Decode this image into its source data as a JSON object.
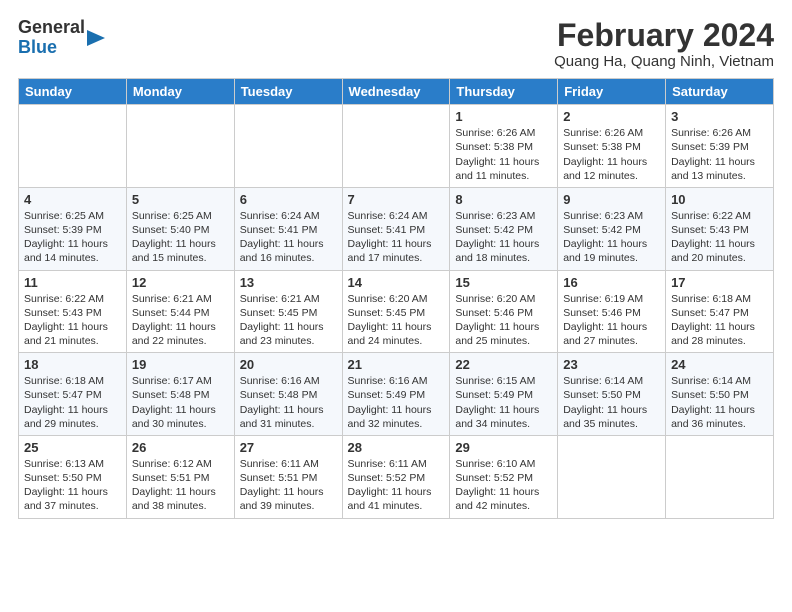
{
  "header": {
    "logo_general": "General",
    "logo_blue": "Blue",
    "title": "February 2024",
    "subtitle": "Quang Ha, Quang Ninh, Vietnam"
  },
  "weekdays": [
    "Sunday",
    "Monday",
    "Tuesday",
    "Wednesday",
    "Thursday",
    "Friday",
    "Saturday"
  ],
  "weeks": [
    [
      {
        "day": "",
        "info": ""
      },
      {
        "day": "",
        "info": ""
      },
      {
        "day": "",
        "info": ""
      },
      {
        "day": "",
        "info": ""
      },
      {
        "day": "1",
        "info": "Sunrise: 6:26 AM\nSunset: 5:38 PM\nDaylight: 11 hours\nand 11 minutes."
      },
      {
        "day": "2",
        "info": "Sunrise: 6:26 AM\nSunset: 5:38 PM\nDaylight: 11 hours\nand 12 minutes."
      },
      {
        "day": "3",
        "info": "Sunrise: 6:26 AM\nSunset: 5:39 PM\nDaylight: 11 hours\nand 13 minutes."
      }
    ],
    [
      {
        "day": "4",
        "info": "Sunrise: 6:25 AM\nSunset: 5:39 PM\nDaylight: 11 hours\nand 14 minutes."
      },
      {
        "day": "5",
        "info": "Sunrise: 6:25 AM\nSunset: 5:40 PM\nDaylight: 11 hours\nand 15 minutes."
      },
      {
        "day": "6",
        "info": "Sunrise: 6:24 AM\nSunset: 5:41 PM\nDaylight: 11 hours\nand 16 minutes."
      },
      {
        "day": "7",
        "info": "Sunrise: 6:24 AM\nSunset: 5:41 PM\nDaylight: 11 hours\nand 17 minutes."
      },
      {
        "day": "8",
        "info": "Sunrise: 6:23 AM\nSunset: 5:42 PM\nDaylight: 11 hours\nand 18 minutes."
      },
      {
        "day": "9",
        "info": "Sunrise: 6:23 AM\nSunset: 5:42 PM\nDaylight: 11 hours\nand 19 minutes."
      },
      {
        "day": "10",
        "info": "Sunrise: 6:22 AM\nSunset: 5:43 PM\nDaylight: 11 hours\nand 20 minutes."
      }
    ],
    [
      {
        "day": "11",
        "info": "Sunrise: 6:22 AM\nSunset: 5:43 PM\nDaylight: 11 hours\nand 21 minutes."
      },
      {
        "day": "12",
        "info": "Sunrise: 6:21 AM\nSunset: 5:44 PM\nDaylight: 11 hours\nand 22 minutes."
      },
      {
        "day": "13",
        "info": "Sunrise: 6:21 AM\nSunset: 5:45 PM\nDaylight: 11 hours\nand 23 minutes."
      },
      {
        "day": "14",
        "info": "Sunrise: 6:20 AM\nSunset: 5:45 PM\nDaylight: 11 hours\nand 24 minutes."
      },
      {
        "day": "15",
        "info": "Sunrise: 6:20 AM\nSunset: 5:46 PM\nDaylight: 11 hours\nand 25 minutes."
      },
      {
        "day": "16",
        "info": "Sunrise: 6:19 AM\nSunset: 5:46 PM\nDaylight: 11 hours\nand 27 minutes."
      },
      {
        "day": "17",
        "info": "Sunrise: 6:18 AM\nSunset: 5:47 PM\nDaylight: 11 hours\nand 28 minutes."
      }
    ],
    [
      {
        "day": "18",
        "info": "Sunrise: 6:18 AM\nSunset: 5:47 PM\nDaylight: 11 hours\nand 29 minutes."
      },
      {
        "day": "19",
        "info": "Sunrise: 6:17 AM\nSunset: 5:48 PM\nDaylight: 11 hours\nand 30 minutes."
      },
      {
        "day": "20",
        "info": "Sunrise: 6:16 AM\nSunset: 5:48 PM\nDaylight: 11 hours\nand 31 minutes."
      },
      {
        "day": "21",
        "info": "Sunrise: 6:16 AM\nSunset: 5:49 PM\nDaylight: 11 hours\nand 32 minutes."
      },
      {
        "day": "22",
        "info": "Sunrise: 6:15 AM\nSunset: 5:49 PM\nDaylight: 11 hours\nand 34 minutes."
      },
      {
        "day": "23",
        "info": "Sunrise: 6:14 AM\nSunset: 5:50 PM\nDaylight: 11 hours\nand 35 minutes."
      },
      {
        "day": "24",
        "info": "Sunrise: 6:14 AM\nSunset: 5:50 PM\nDaylight: 11 hours\nand 36 minutes."
      }
    ],
    [
      {
        "day": "25",
        "info": "Sunrise: 6:13 AM\nSunset: 5:50 PM\nDaylight: 11 hours\nand 37 minutes."
      },
      {
        "day": "26",
        "info": "Sunrise: 6:12 AM\nSunset: 5:51 PM\nDaylight: 11 hours\nand 38 minutes."
      },
      {
        "day": "27",
        "info": "Sunrise: 6:11 AM\nSunset: 5:51 PM\nDaylight: 11 hours\nand 39 minutes."
      },
      {
        "day": "28",
        "info": "Sunrise: 6:11 AM\nSunset: 5:52 PM\nDaylight: 11 hours\nand 41 minutes."
      },
      {
        "day": "29",
        "info": "Sunrise: 6:10 AM\nSunset: 5:52 PM\nDaylight: 11 hours\nand 42 minutes."
      },
      {
        "day": "",
        "info": ""
      },
      {
        "day": "",
        "info": ""
      }
    ]
  ]
}
